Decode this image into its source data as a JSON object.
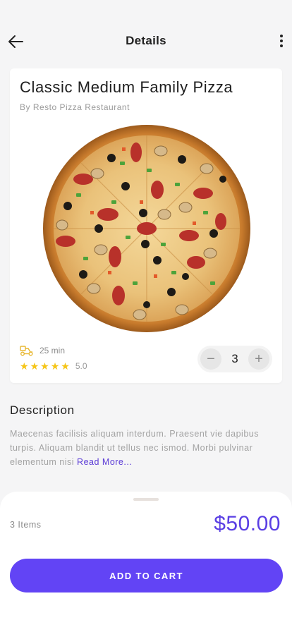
{
  "header": {
    "title": "Details",
    "back_icon": "arrow-left-icon",
    "more_icon": "more-vertical-icon"
  },
  "product": {
    "name": "Classic Medium Family Pizza",
    "restaurant": "By Resto Pizza Restaurant",
    "delivery_icon": "delivery-scooter-icon",
    "delivery_time": "25 min",
    "rating_stars": 5,
    "rating_value": "5.0",
    "quantity": "3",
    "minus_label": "−",
    "plus_label": "+"
  },
  "description": {
    "title": "Description",
    "body": "Maecenas facilisis aliquam interdum. Praesent vie dapibus turpis. Aliquam blandit ut tellus nec ismod. Morbi pulvinar elementum nisi ",
    "read_more": "Read More..."
  },
  "checkout": {
    "items_label": "3 Items",
    "total": "$50.00",
    "cta": "ADD TO CART"
  },
  "colors": {
    "accent": "#6244f5",
    "price": "#5a3fe4",
    "star": "#f5c518",
    "background": "#f5f5f6"
  }
}
